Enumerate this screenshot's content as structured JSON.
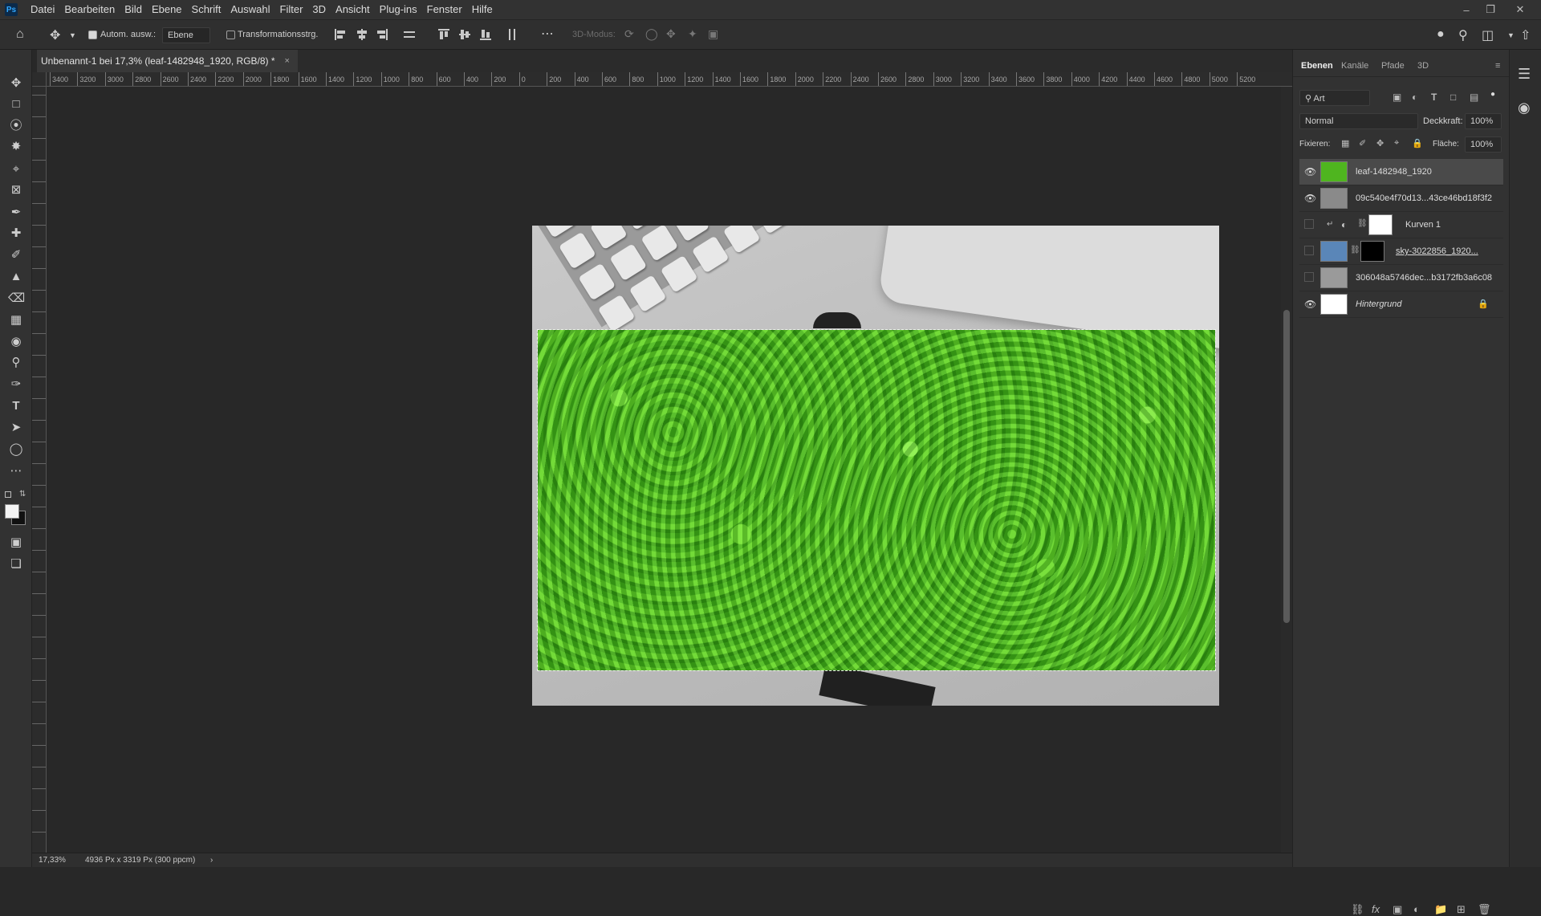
{
  "menubar": {
    "logo": "Ps",
    "items": [
      "Datei",
      "Bearbeiten",
      "Bild",
      "Ebene",
      "Schrift",
      "Auswahl",
      "Filter",
      "3D",
      "Ansicht",
      "Plug-ins",
      "Fenster",
      "Hilfe"
    ]
  },
  "options": {
    "auto_select_label": "Autom. ausw.:",
    "auto_select_target": "Ebene",
    "transform_label": "Transformationsstrg.",
    "mode_3d_label": "3D-Modus:"
  },
  "document_tab": {
    "title": "Unbenannt-1 bei 17,3% (leaf-1482948_1920, RGB/8) *",
    "close": "×"
  },
  "ruler": {
    "labels": [
      "3400",
      "3200",
      "3000",
      "2800",
      "2600",
      "2400",
      "2200",
      "2000",
      "1800",
      "1600",
      "1400",
      "1200",
      "1000",
      "800",
      "600",
      "400",
      "200",
      "0",
      "200",
      "400",
      "600",
      "800",
      "1000",
      "1200",
      "1400",
      "1600",
      "1800",
      "2000",
      "2200",
      "2400",
      "2600",
      "2800",
      "3000",
      "3200",
      "3400",
      "3600",
      "3800",
      "4000",
      "4200",
      "4400",
      "4600",
      "4800",
      "5000",
      "5200"
    ]
  },
  "statusbar": {
    "zoom": "17,33%",
    "doc_info": "4936 Px x 3319 Px (300 ppcm)",
    "arrow": "›"
  },
  "layers_panel": {
    "tabs": [
      "Ebenen",
      "Kanäle",
      "Pfade",
      "3D"
    ],
    "filter_kind": "Art",
    "blend_mode": "Normal",
    "opacity_label": "Deckkraft:",
    "opacity_value": "100%",
    "lock_label": "Fixieren:",
    "fill_label": "Fläche:",
    "fill_value": "100%",
    "layers": [
      {
        "name": "leaf-1482948_1920",
        "visible": true,
        "selected": true
      },
      {
        "name": "09c540e4f70d13...43ce46bd18f3f2",
        "visible": true,
        "selected": false
      },
      {
        "name": "Kurven 1",
        "visible": false,
        "selected": false
      },
      {
        "name": "sky-3022856_1920...",
        "visible": false,
        "selected": false
      },
      {
        "name": "306048a5746dec...b3172fb3a6c08",
        "visible": false,
        "selected": false
      },
      {
        "name": "Hintergrund",
        "visible": true,
        "selected": false
      }
    ]
  },
  "colors": {
    "accent": "#31a8ff",
    "clover": "#4fb51f",
    "panel_bg": "#323232",
    "canvas_bg": "#282828"
  }
}
